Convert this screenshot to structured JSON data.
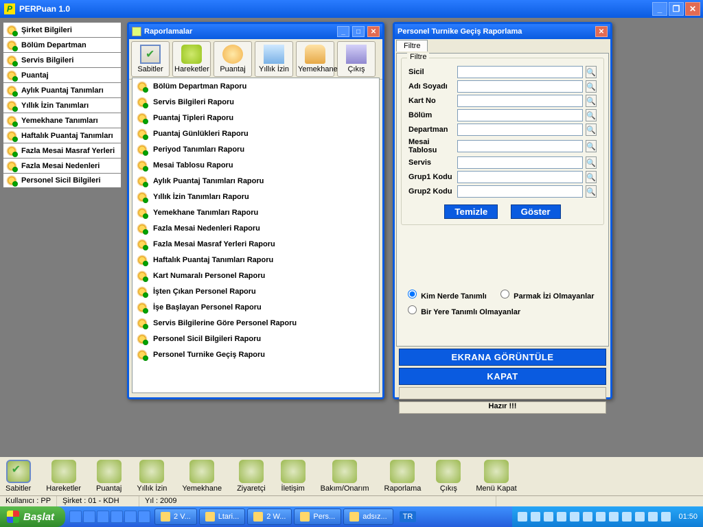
{
  "app": {
    "title": "PERPuan 1.0"
  },
  "sidebar": {
    "items": [
      {
        "label": "Şirket Bilgileri"
      },
      {
        "label": "Bölüm Departman"
      },
      {
        "label": "Servis Bilgileri"
      },
      {
        "label": "Puantaj"
      },
      {
        "label": "Aylık Puantaj Tanımları"
      },
      {
        "label": "Yıllık İzin Tanımları"
      },
      {
        "label": "Yemekhane Tanımları"
      },
      {
        "label": "Haftalık Puantaj Tanımları"
      },
      {
        "label": "Fazla Mesai Masraf Yerleri"
      },
      {
        "label": "Fazla Mesai Nedenleri"
      },
      {
        "label": "Personel Sicil Bilgileri"
      }
    ]
  },
  "rapor": {
    "title": "Raporlamalar",
    "toolbar": [
      {
        "label": "Sabitler"
      },
      {
        "label": "Hareketler"
      },
      {
        "label": "Puantaj"
      },
      {
        "label": "Yıllık İzin"
      },
      {
        "label": "Yemekhane"
      },
      {
        "label": "Çıkış"
      }
    ],
    "items": [
      {
        "label": "Bölüm Departman Raporu"
      },
      {
        "label": "Servis Bilgileri Raporu"
      },
      {
        "label": "Puantaj Tipleri Raporu"
      },
      {
        "label": "Puantaj Günlükleri Raporu"
      },
      {
        "label": "Periyod Tanımları Raporu"
      },
      {
        "label": "Mesai Tablosu Raporu"
      },
      {
        "label": "Aylık Puantaj Tanımları Raporu"
      },
      {
        "label": "Yıllık İzin Tanımları Raporu"
      },
      {
        "label": "Yemekhane Tanımları Raporu"
      },
      {
        "label": "Fazla Mesai Nedenleri Raporu"
      },
      {
        "label": "Fazla Mesai Masraf Yerleri Raporu"
      },
      {
        "label": "Haftalık Puantaj Tanımları Raporu"
      },
      {
        "label": "Kart Numaralı Personel Raporu"
      },
      {
        "label": "İşten Çıkan Personel Raporu"
      },
      {
        "label": "İşe Başlayan Personel Raporu"
      },
      {
        "label": "Servis Bilgilerine Göre Personel Raporu"
      },
      {
        "label": "Personel Sicil Bilgileri Raporu"
      },
      {
        "label": "Personel Turnike Geçiş Raporu"
      }
    ]
  },
  "filter": {
    "title": "Personel Turnike Geçiş Raporlama",
    "tab": "Filtre",
    "group": "Filtre",
    "fields": [
      {
        "label": "Sicil"
      },
      {
        "label": "Adı Soyadı"
      },
      {
        "label": "Kart No"
      },
      {
        "label": "Bölüm"
      },
      {
        "label": "Departman"
      },
      {
        "label": "Mesai Tablosu"
      },
      {
        "label": "Servis"
      },
      {
        "label": "Grup1 Kodu"
      },
      {
        "label": "Grup2 Kodu"
      }
    ],
    "clear": "Temizle",
    "show": "Göster",
    "radios": {
      "r1": "Kim Nerde Tanımlı",
      "r2": "Parmak İzi Olmayanlar",
      "r3": "Bir Yere Tanımlı Olmayanlar"
    },
    "view": "EKRANA GÖRÜNTÜLE",
    "close": "KAPAT",
    "status": "Hazır !!!"
  },
  "apptoolbar": [
    {
      "label": "Sabitler"
    },
    {
      "label": "Hareketler"
    },
    {
      "label": "Puantaj"
    },
    {
      "label": "Yıllık İzin"
    },
    {
      "label": "Yemekhane"
    },
    {
      "label": "Ziyaretçi"
    },
    {
      "label": "İletişim"
    },
    {
      "label": "Bakım/Onarım"
    },
    {
      "label": "Raporlama"
    },
    {
      "label": "Çıkış"
    },
    {
      "label": "Menü Kapat"
    }
  ],
  "appstatus": {
    "user": "Kullanıcı : PP",
    "company": "Şirket : 01 - KDH",
    "year": "Yıl : 2009"
  },
  "taskbar": {
    "start": "Başlat",
    "tasks": [
      {
        "label": "2 V..."
      },
      {
        "label": "Ltari..."
      },
      {
        "label": "2 W..."
      },
      {
        "label": "Pers..."
      },
      {
        "label": "adsız..."
      }
    ],
    "lang": "TR",
    "clock": "01:50"
  }
}
